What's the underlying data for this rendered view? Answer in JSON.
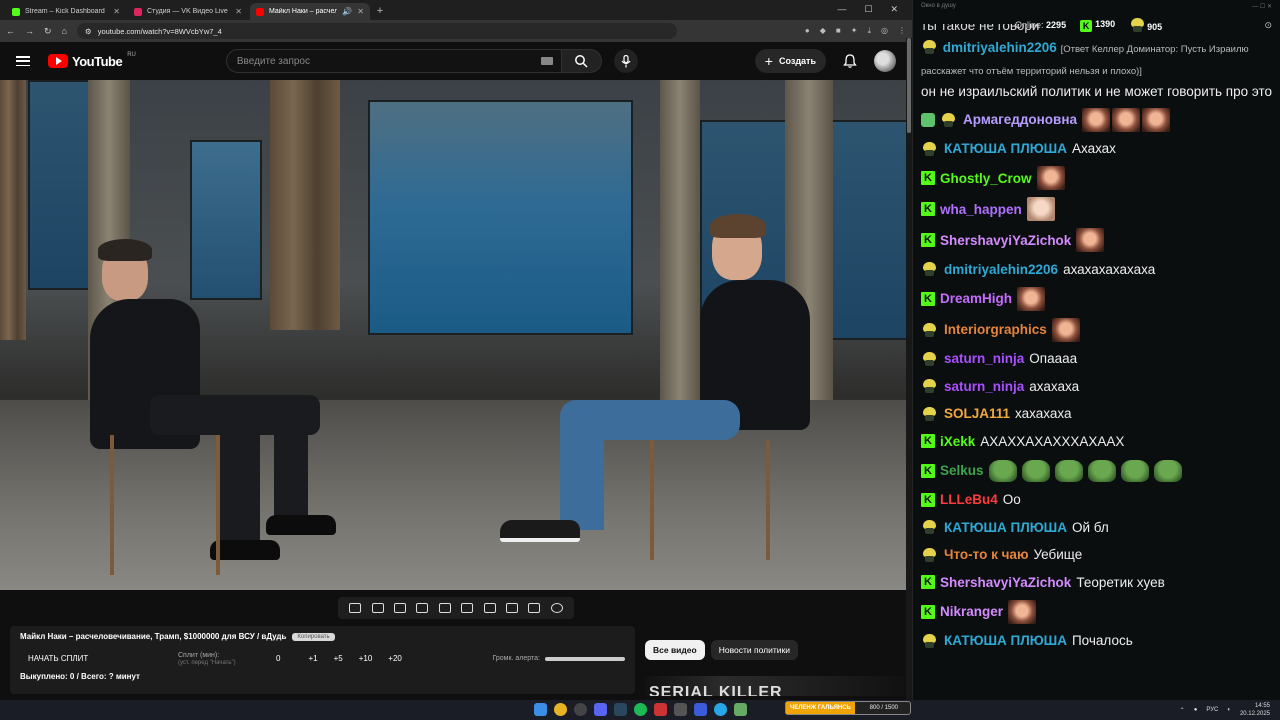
{
  "browser": {
    "tabs": [
      {
        "title": "Stream – Kick Dashboard",
        "color": "#53fc18"
      },
      {
        "title": "Студия — VK Видео Live",
        "color": "#e0245e"
      },
      {
        "title": "Майкл Наки – расчеловеч",
        "color": "#ff0000"
      }
    ],
    "url": "youtube.com/watch?v=8WVcbYw7_4"
  },
  "youtube": {
    "logo": "YouTube",
    "region": "RU",
    "search_placeholder": "Введите запрос",
    "create_label": "Создать"
  },
  "thumbnail_text": "SERIAL   KILLER",
  "stream_panel": {
    "title": "Майкл Наки – расчеловечивание, Трамп, $1000000 для ВСУ / вДудь",
    "copy_label": "Копировать",
    "start_split": "НАЧАТЬ СПЛИТ",
    "split_label": "Сплит (мин):",
    "split_hint": "(уст. перед \"Начать\")",
    "split_value": "0",
    "steps": [
      "+1",
      "+5",
      "+10",
      "+20"
    ],
    "alert_label": "Громк. алерта:",
    "sold": "Выкуплено: 0 / Всего: ? минут"
  },
  "chips": [
    "Все видео",
    "Новости политики"
  ],
  "chat": {
    "window_title": "Окно в душу",
    "online_label": "Online:",
    "online_value": "2295",
    "kick_count": "1390",
    "vk_count": "905",
    "pinned_fragment": "ты такое не говори",
    "reply": {
      "nick": "dmitriyalehin2206",
      "context": "[Ответ Келлер Доминатор: Пусть Израилю расскажет что отъём территорий нельзя и плохо)]",
      "text": "он не израильский политик и не может говорить про это"
    },
    "messages": [
      {
        "nick": "Армагеддоновна",
        "color": "#b79cff",
        "badge": "sp",
        "text": "",
        "emotes": 3
      },
      {
        "nick": "КАТЮША ПЛЮША",
        "color": "#2ea9d6",
        "badge": "p",
        "text": "Ахахах",
        "emotes": 0
      },
      {
        "nick": "Ghostly_Crow",
        "color": "#53fc18",
        "badge": "k",
        "text": "",
        "emotes": 1
      },
      {
        "nick": "wha_happen",
        "color": "#b070ff",
        "badge": "k",
        "text": "",
        "emotes": 1,
        "pale": true
      },
      {
        "nick": "ShershavyiYaZichok",
        "color": "#d48bff",
        "badge": "k",
        "text": "",
        "emotes": 1
      },
      {
        "nick": "dmitriyalehin2206",
        "color": "#2ea9d6",
        "badge": "p",
        "text": "ахахахахахаха",
        "emotes": 0
      },
      {
        "nick": "DreamHigh",
        "color": "#c66bff",
        "badge": "k",
        "text": "",
        "emotes": 1
      },
      {
        "nick": "Interiorgraphics",
        "color": "#e6833d",
        "badge": "p",
        "text": "",
        "emotes": 1
      },
      {
        "nick": "saturn_ninja",
        "color": "#a84fff",
        "badge": "p",
        "text": "Опаааа",
        "emotes": 0
      },
      {
        "nick": "saturn_ninja",
        "color": "#a84fff",
        "badge": "p",
        "text": "ахахаха",
        "emotes": 0
      },
      {
        "nick": "SOLJA111",
        "color": "#f2a93b",
        "badge": "p",
        "text": "хахахаха",
        "emotes": 0
      },
      {
        "nick": "iXekk",
        "color": "#53fc18",
        "badge": "k",
        "text": "АХАХХАХАХХХАХААХ",
        "emotes": 0
      },
      {
        "nick": "Selkus",
        "color": "#3fa34d",
        "badge": "k",
        "text": "",
        "emotes": 6,
        "frog": true
      },
      {
        "nick": "LLLeBu4",
        "color": "#ff3b3b",
        "badge": "k",
        "text": "Оо",
        "emotes": 0
      },
      {
        "nick": "КАТЮША ПЛЮША",
        "color": "#2ea9d6",
        "badge": "p",
        "text": "Ой бл",
        "emotes": 0
      },
      {
        "nick": "Что-то к чаю",
        "color": "#e6833d",
        "badge": "p",
        "text": "Уебище",
        "emotes": 0
      },
      {
        "nick": "ShershavyiYaZichok",
        "color": "#d48bff",
        "badge": "k",
        "text": "Теоретик хуев",
        "emotes": 0
      },
      {
        "nick": "Nikranger",
        "color": "#d48bff",
        "badge": "k",
        "text": "",
        "emotes": 1
      },
      {
        "nick": "КАТЮША ПЛЮША",
        "color": "#2ea9d6",
        "badge": "p",
        "text": "Почалось",
        "emotes": 0
      }
    ]
  },
  "taskbar": {
    "overlay_label": "ЧЕЛЕНЖ ГАЛЬЯНСЬ",
    "overlay_value": "800 / 1500",
    "lang": "РУС",
    "time": "14:55",
    "date": "20.12.2025"
  }
}
